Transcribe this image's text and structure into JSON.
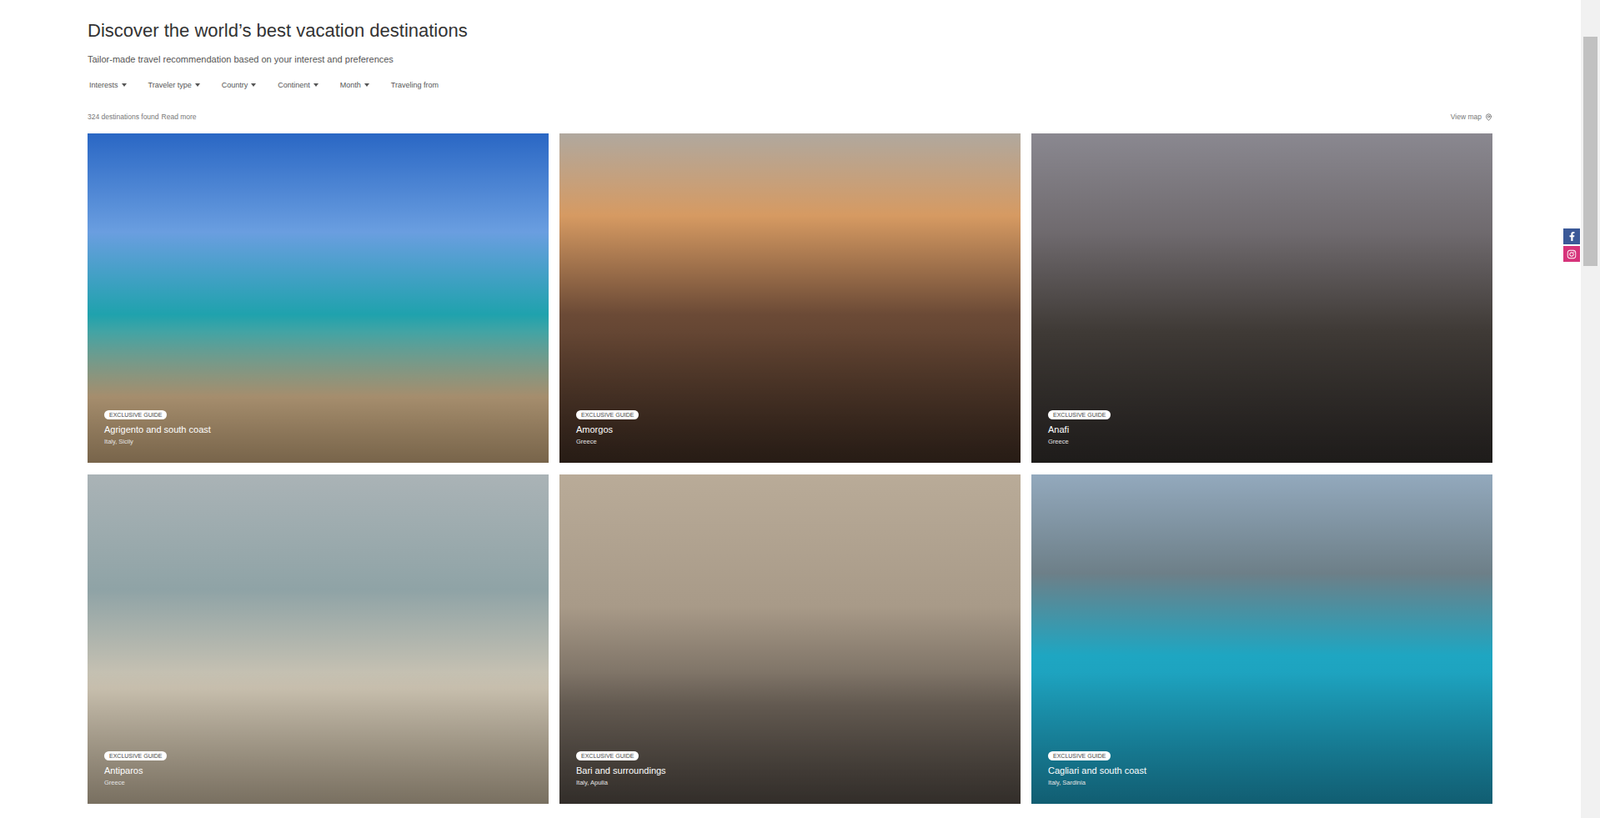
{
  "page": {
    "title": "Discover the world’s best vacation destinations",
    "subtitle": "Tailor-made travel recommendation based on your interest and preferences"
  },
  "filters": [
    {
      "label": "Interests",
      "dropdown": true
    },
    {
      "label": "Traveler type",
      "dropdown": true
    },
    {
      "label": "Country",
      "dropdown": true
    },
    {
      "label": "Continent",
      "dropdown": true
    },
    {
      "label": "Month",
      "dropdown": true
    },
    {
      "label": "Traveling from",
      "dropdown": false
    }
  ],
  "results": {
    "count": "324 destinations found",
    "read_more": "Read more"
  },
  "view_map": {
    "label": "View map"
  },
  "destinations": [
    {
      "badge": "EXCLUSIVE GUIDE",
      "name": "Agrigento and south coast",
      "region": "Italy, Sicily"
    },
    {
      "badge": "EXCLUSIVE GUIDE",
      "name": "Amorgos",
      "region": "Greece"
    },
    {
      "badge": "EXCLUSIVE GUIDE",
      "name": "Anafi",
      "region": "Greece"
    },
    {
      "badge": "EXCLUSIVE GUIDE",
      "name": "Antiparos",
      "region": "Greece"
    },
    {
      "badge": "EXCLUSIVE GUIDE",
      "name": "Bari and surroundings",
      "region": "Italy, Apulia"
    },
    {
      "badge": "EXCLUSIVE GUIDE",
      "name": "Cagliari and south coast",
      "region": "Italy, Sardinia"
    }
  ],
  "scrollbar": {
    "position": 0.045,
    "size": 0.28
  }
}
